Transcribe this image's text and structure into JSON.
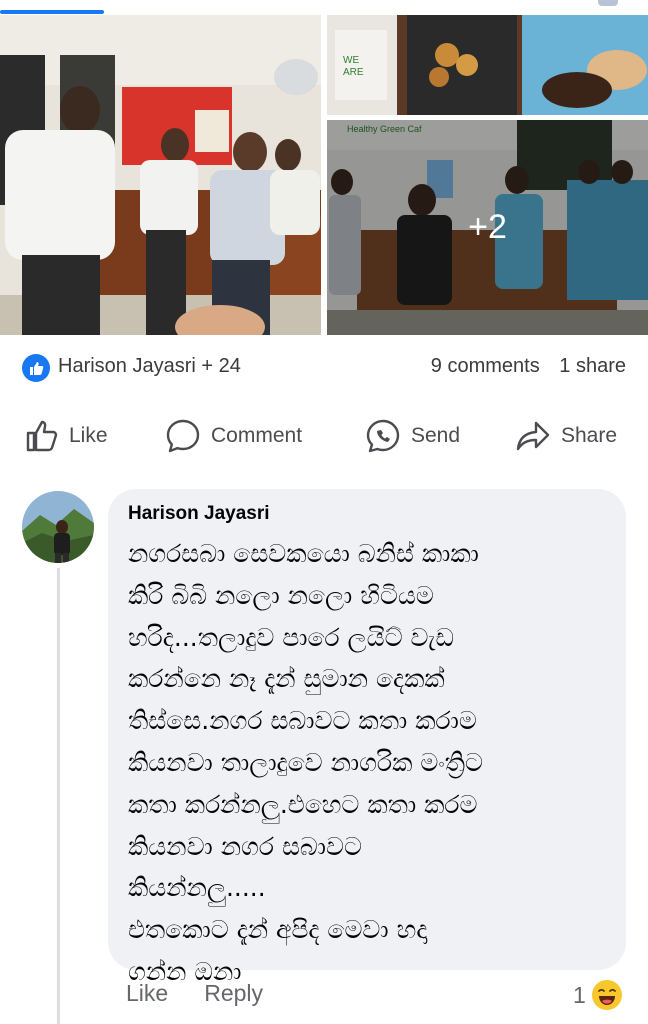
{
  "post": {
    "more_photos_label": "+2"
  },
  "reactions": {
    "names": "Harison Jayasri + 24",
    "comments": "9 comments",
    "shares": "1 share"
  },
  "actions": {
    "like": "Like",
    "comment": "Comment",
    "send": "Send",
    "share": "Share"
  },
  "comment": {
    "author": "Harison Jayasri",
    "lines": [
      "නගරසබා සෙවකයො බනිස් කාකා",
      "කිරි බිබි නලො නලො හිටියම",
      "හරිද...තලාදුව පාරෙ ලයිට් වැඩ",
      "කරන්නෙ නෑ දැන් සුමාන දෙකක්",
      "තිස්සෙ.නගර සබාවට කතා කරාම",
      "කියනවා තාලාදුවෙ නාගරික මංත්‍රිට",
      "කතා කරන්නලු.එහෙට කතා කරම",
      "කියනවා නගර සබාවට",
      "කියන්නලු.....",
      "එතකොට දැන් අපිද මෙවා හදා",
      "ගන්න ඔනා"
    ],
    "like_label": "Like",
    "reply_label": "Reply",
    "reaction_count": "1"
  },
  "colors": {
    "accent": "#1877f2",
    "bubble": "#eff1f4",
    "muted_text": "#65676b"
  },
  "icons": [
    "like-icon",
    "comment-icon",
    "send-icon",
    "share-icon",
    "laughing-emoji-icon"
  ]
}
